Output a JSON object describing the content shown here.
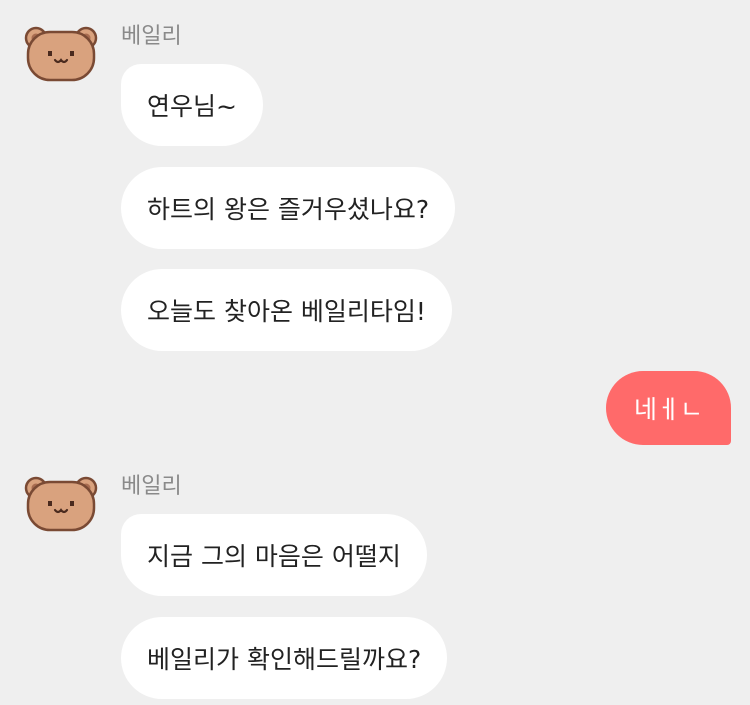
{
  "colors": {
    "background": "#efefef",
    "incoming_bubble": "#ffffff",
    "outgoing_bubble": "#ff6a6a",
    "sender_name": "#8a8a8a",
    "avatar": "#d9a27e"
  },
  "groups": [
    {
      "sender": "베일리",
      "avatar_icon": "bear-face-icon",
      "messages": [
        "연우님~",
        "하트의 왕은 즐거우셨나요?",
        "오늘도 찾아온 베일리타임!"
      ]
    },
    {
      "sender": "베일리",
      "avatar_icon": "bear-face-icon",
      "messages": [
        "지금 그의 마음은 어떨지",
        "베일리가 확인해드릴까요?"
      ]
    }
  ],
  "outgoing": [
    "네ㅔㄴ"
  ]
}
